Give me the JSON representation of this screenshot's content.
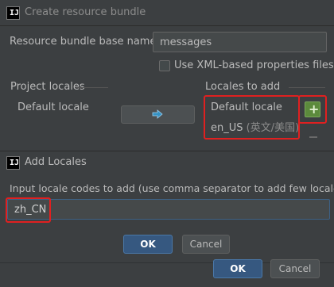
{
  "create_bundle": {
    "title": "Create resource bundle",
    "base_name_label": "Resource bundle base name:",
    "base_name_value": "messages",
    "xml_checkbox_label": "Use XML-based properties files",
    "xml_checkbox_checked": false,
    "project_locales_header": "Project locales",
    "project_locales": [
      "Default locale"
    ],
    "locales_to_add_header": "Locales to add",
    "locales_to_add": [
      {
        "name": "Default locale",
        "native": ""
      },
      {
        "name": "en_US",
        "native": "(英文/美国)"
      }
    ],
    "ok_label": "OK",
    "cancel_label": "Cancel"
  },
  "add_locales": {
    "title": "Add Locales",
    "prompt": "Input locale codes to add (use comma separator to add few locales)",
    "input_value": "zh_CN",
    "ok_label": "OK",
    "cancel_label": "Cancel"
  },
  "colors": {
    "background": "#3c3f41",
    "highlight_red": "#e02020",
    "primary_button": "#365880",
    "add_button_green": "#5c8a3c"
  },
  "icons": {
    "app": "intellij-icon",
    "move_right": "arrow-right-icon",
    "add": "plus-icon",
    "remove": "minus-icon"
  }
}
